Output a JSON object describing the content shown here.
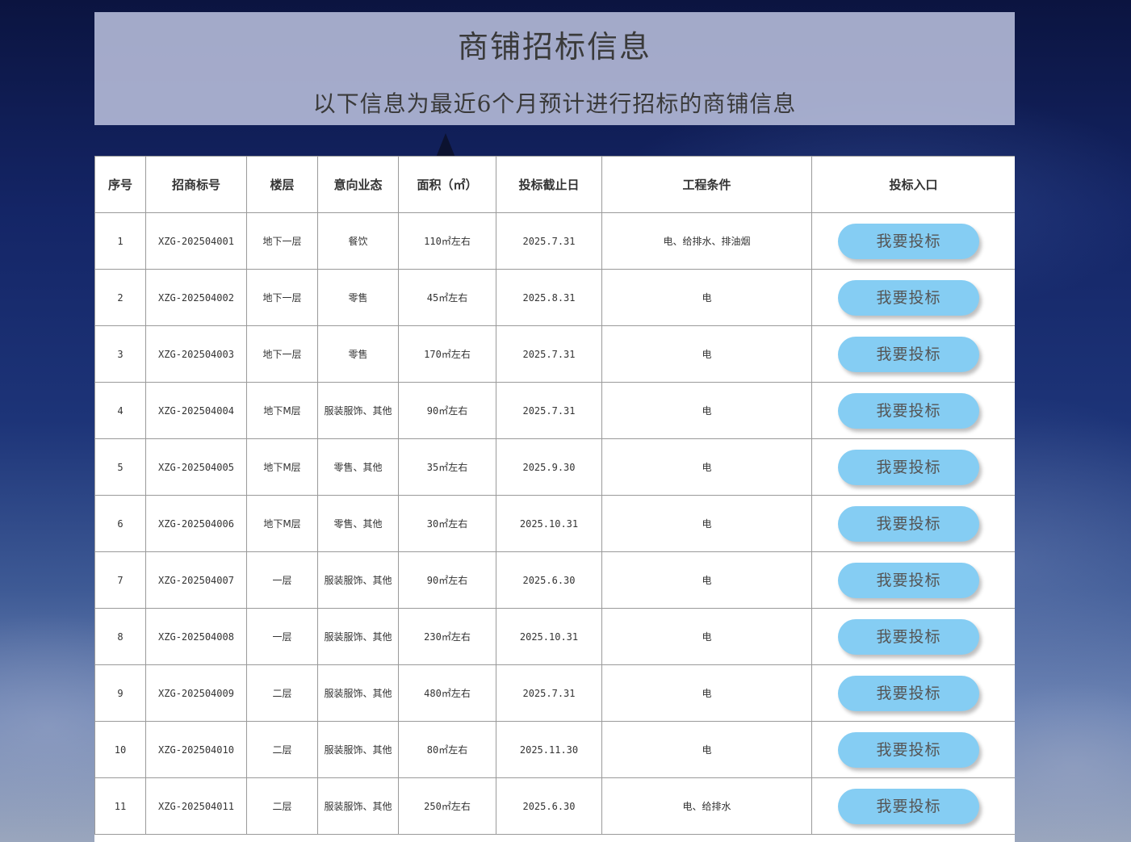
{
  "header": {
    "title": "商铺招标信息",
    "subtitle": "以下信息为最近6个月预计进行招标的商铺信息"
  },
  "table": {
    "columns": [
      "序号",
      "招商标号",
      "楼层",
      "意向业态",
      "面积（㎡）",
      "投标截止日",
      "工程条件",
      "投标入口"
    ],
    "button_label": "我要投标",
    "rows": [
      {
        "no": "1",
        "code": "XZG-202504001",
        "floor": "地下一层",
        "type": "餐饮",
        "area": "110㎡左右",
        "deadline": "2025.7.31",
        "condition": "电、给排水、排油烟"
      },
      {
        "no": "2",
        "code": "XZG-202504002",
        "floor": "地下一层",
        "type": "零售",
        "area": "45㎡左右",
        "deadline": "2025.8.31",
        "condition": "电"
      },
      {
        "no": "3",
        "code": "XZG-202504003",
        "floor": "地下一层",
        "type": "零售",
        "area": "170㎡左右",
        "deadline": "2025.7.31",
        "condition": "电"
      },
      {
        "no": "4",
        "code": "XZG-202504004",
        "floor": "地下M层",
        "type": "服装服饰、其他",
        "area": "90㎡左右",
        "deadline": "2025.7.31",
        "condition": "电"
      },
      {
        "no": "5",
        "code": "XZG-202504005",
        "floor": "地下M层",
        "type": "零售、其他",
        "area": "35㎡左右",
        "deadline": "2025.9.30",
        "condition": "电"
      },
      {
        "no": "6",
        "code": "XZG-202504006",
        "floor": "地下M层",
        "type": "零售、其他",
        "area": "30㎡左右",
        "deadline": "2025.10.31",
        "condition": "电"
      },
      {
        "no": "7",
        "code": "XZG-202504007",
        "floor": "一层",
        "type": "服装服饰、其他",
        "area": "90㎡左右",
        "deadline": "2025.6.30",
        "condition": "电"
      },
      {
        "no": "8",
        "code": "XZG-202504008",
        "floor": "一层",
        "type": "服装服饰、其他",
        "area": "230㎡左右",
        "deadline": "2025.10.31",
        "condition": "电"
      },
      {
        "no": "9",
        "code": "XZG-202504009",
        "floor": "二层",
        "type": "服装服饰、其他",
        "area": "480㎡左右",
        "deadline": "2025.7.31",
        "condition": "电"
      },
      {
        "no": "10",
        "code": "XZG-202504010",
        "floor": "二层",
        "type": "服装服饰、其他",
        "area": "80㎡左右",
        "deadline": "2025.11.30",
        "condition": "电"
      },
      {
        "no": "11",
        "code": "XZG-202504011",
        "floor": "二层",
        "type": "服装服饰、其他",
        "area": "250㎡左右",
        "deadline": "2025.6.30",
        "condition": "电、给排水"
      }
    ]
  }
}
